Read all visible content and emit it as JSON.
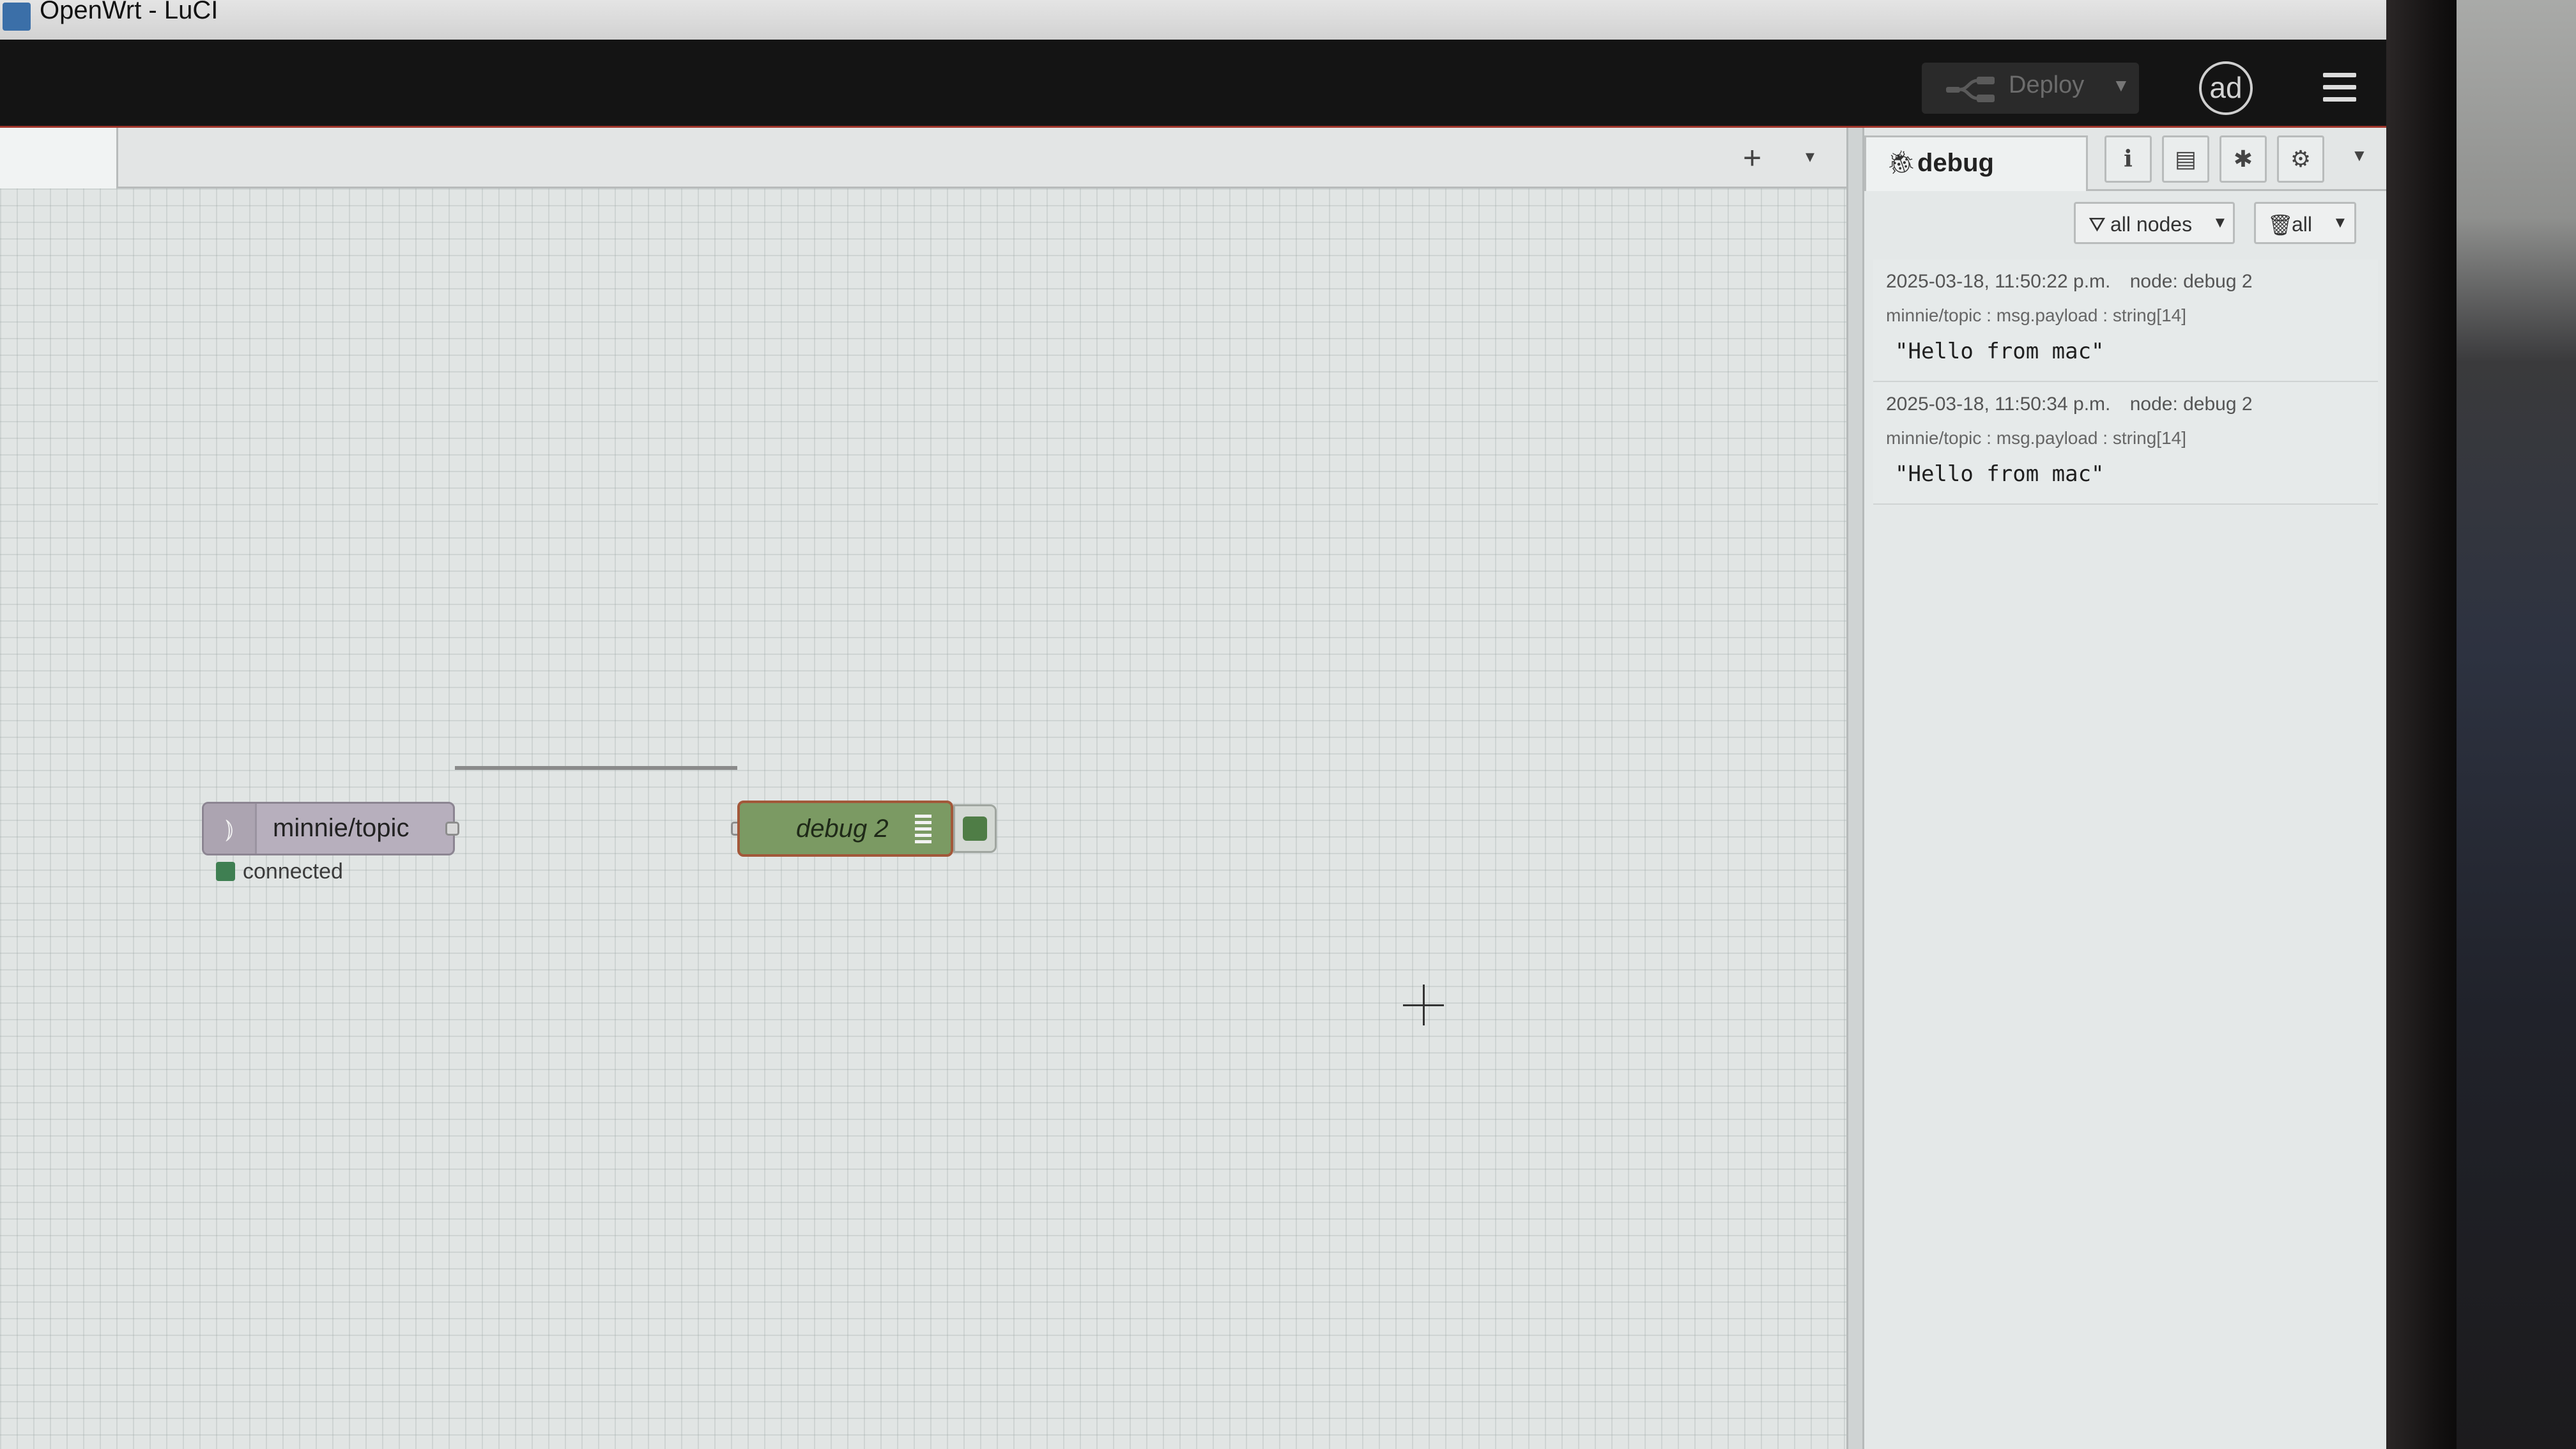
{
  "window": {
    "title": "OpenWrt - LuCI"
  },
  "header": {
    "deploy_label": "Deploy",
    "user_initials": "ad"
  },
  "workspace": {
    "add_flow_symbol": "+",
    "tab_list_symbol": "▾",
    "nodes": {
      "mqtt_in": {
        "label": "minnie/topic",
        "status": "connected",
        "status_color": "#3f7f52",
        "color": "#b7afbd"
      },
      "debug": {
        "label": "debug 2",
        "color": "#7b9a63"
      }
    }
  },
  "sidebar": {
    "active_tab": "debug",
    "filter_label": "all nodes",
    "clear_label": "all",
    "messages": [
      {
        "timestamp": "2025-03-18, 11:50:22 p.m.",
        "node": "node: debug 2",
        "meta": "minnie/topic : msg.payload : string[14]",
        "payload": "\"Hello from mac\""
      },
      {
        "timestamp": "2025-03-18, 11:50:34 p.m.",
        "node": "node: debug 2",
        "meta": "minnie/topic : msg.payload : string[14]",
        "payload": "\"Hello from mac\""
      }
    ]
  },
  "colors": {
    "header_bg": "#141414",
    "header_accent": "#a0362c",
    "canvas_bg": "#e1e5e4",
    "sidebar_bg": "#e4e8e8"
  }
}
